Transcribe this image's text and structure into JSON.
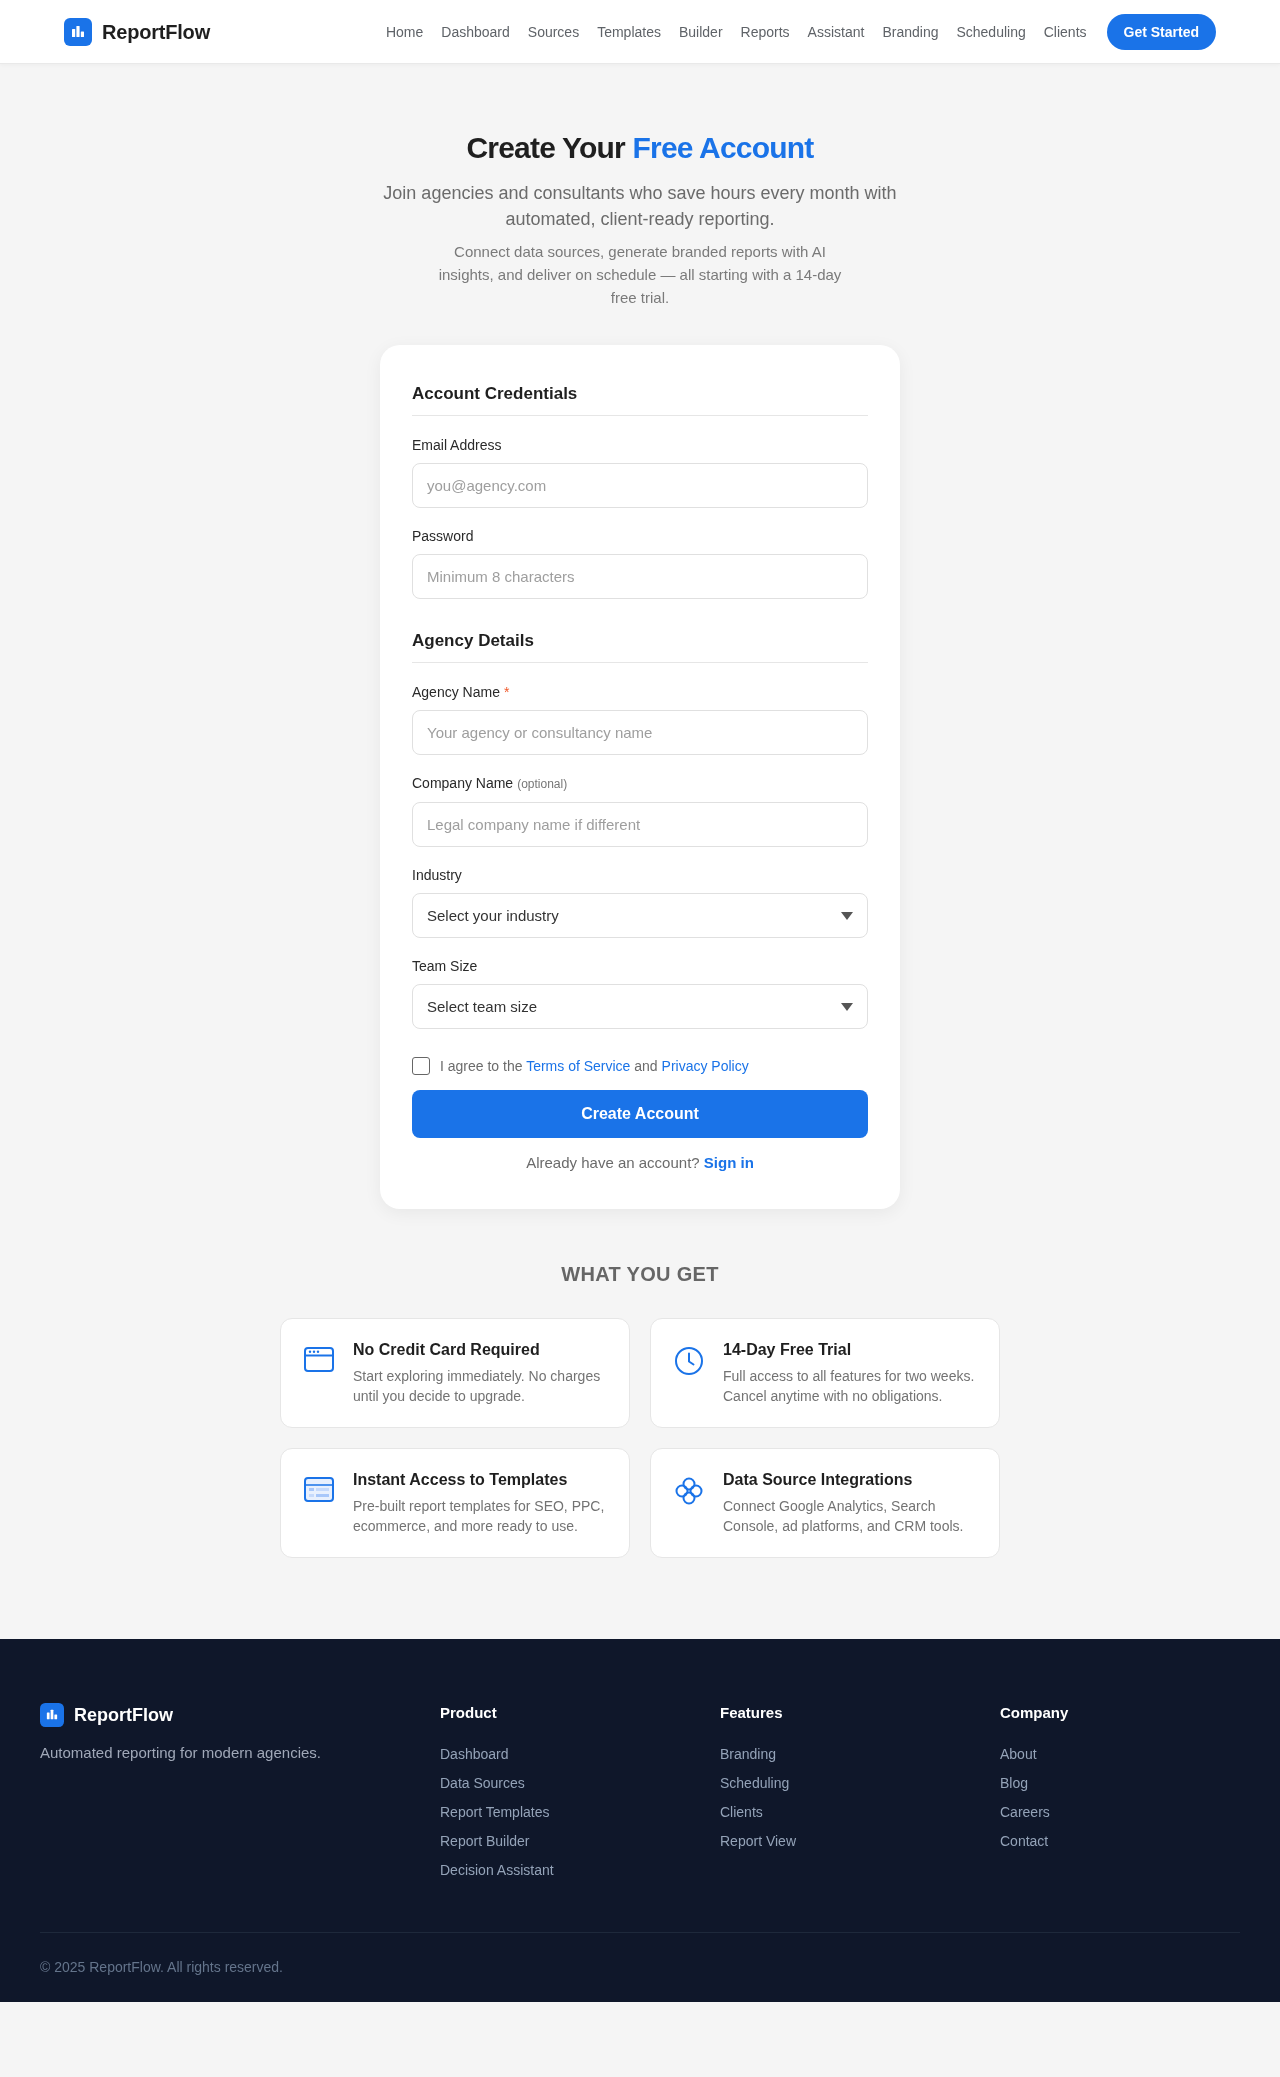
{
  "header": {
    "brand": "ReportFlow",
    "nav": [
      "Home",
      "Dashboard",
      "Sources",
      "Templates",
      "Builder",
      "Reports",
      "Assistant",
      "Branding",
      "Scheduling",
      "Clients"
    ],
    "cta": "Get Started"
  },
  "hero": {
    "title": "Create Your",
    "title_highlight": "Free Account",
    "subtitle": "Join agencies and consultants who save hours every month with automated, client-ready reporting.",
    "description": "Connect data sources, generate branded reports with AI insights, and deliver on schedule — all starting with a 14-day free trial."
  },
  "form": {
    "sections": [
      {
        "heading": "Account Credentials",
        "fields": [
          {
            "kind": "input",
            "label": "Email Address",
            "placeholder": "you@agency.com"
          },
          {
            "kind": "input",
            "label": "Password",
            "placeholder": "Minimum 8 characters"
          }
        ]
      },
      {
        "heading": "Agency Details",
        "fields": [
          {
            "kind": "input",
            "label": "Agency Name",
            "required_mark": "*",
            "placeholder": "Your agency or consultancy name"
          },
          {
            "kind": "input",
            "label": "Company Name",
            "note": "(optional)",
            "placeholder": "Legal company name if different"
          },
          {
            "kind": "select",
            "label": "Industry",
            "value": "Select your industry"
          },
          {
            "kind": "select",
            "label": "Team Size",
            "value": "Select team size"
          }
        ]
      }
    ],
    "agreement": {
      "checked": false,
      "segments": [
        {
          "kind": "text",
          "text": "I agree to the"
        },
        {
          "kind": "link",
          "text": "Terms of Service"
        },
        {
          "kind": "text",
          "text": "and"
        },
        {
          "kind": "link",
          "text": "Privacy Policy"
        }
      ]
    },
    "submit": "Create Account",
    "signin": {
      "prompt": "Already have an account?",
      "link": "Sign in"
    }
  },
  "benefits": {
    "heading": "WHAT YOU GET",
    "items": [
      {
        "title": "No Credit Card Required",
        "description": "Start exploring immediately. No charges until you decide to upgrade."
      },
      {
        "title": "14-Day Free Trial",
        "description": "Full access to all features for two weeks. Cancel anytime with no obligations."
      },
      {
        "title": "Instant Access to Templates",
        "description": "Pre-built report templates for SEO, PPC, ecommerce, and more ready to use."
      },
      {
        "title": "Data Source Integrations",
        "description": "Connect Google Analytics, Search Console, ad platforms, and CRM tools."
      }
    ]
  },
  "footer": {
    "brand": "ReportFlow",
    "tagline": "Automated reporting for modern agencies.",
    "columns": [
      {
        "heading": "Product",
        "links": [
          "Dashboard",
          "Data Sources",
          "Report Templates",
          "Report Builder",
          "Decision Assistant"
        ]
      },
      {
        "heading": "Features",
        "links": [
          "Branding",
          "Scheduling",
          "Clients",
          "Report View"
        ]
      },
      {
        "heading": "Company",
        "links": [
          "About",
          "Blog",
          "Careers",
          "Contact"
        ]
      }
    ],
    "copyright": "© 2025 ReportFlow. All rights reserved."
  }
}
